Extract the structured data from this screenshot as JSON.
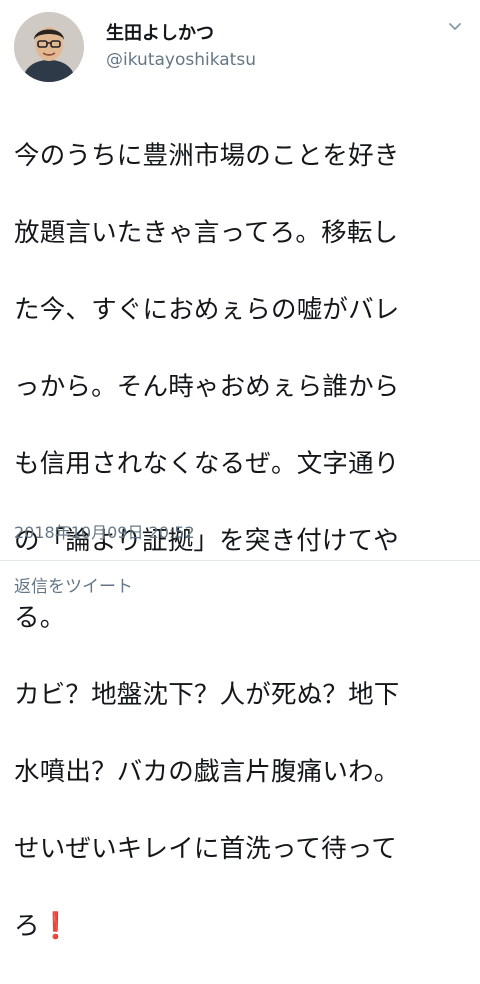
{
  "tweet": {
    "author": {
      "display_name": "生田よしかつ",
      "handle": "@ikutayoshikatsu",
      "avatar_icon": "user-avatar"
    },
    "menu_icon": "chevron-down-icon",
    "lines": [
      "今のうちに豊洲市場のことを好き",
      "放題言いたきゃ言ってろ。移転し",
      "た今、すぐにおめぇらの嘘がバレ",
      "っから。そん時ゃおめぇら誰から",
      "も信用されなくなるぜ。文字通り",
      "の「論より証拠」を突き付けてや",
      "る。",
      "カビ？地盤沈下？人が死ぬ？地下",
      "水噴出？バカの戯言片腹痛いわ。",
      "せいぜいキレイに首洗って待って",
      "ろ"
    ],
    "emoji": "❗",
    "timestamp": "2018年10月09日 20:52",
    "reply_label": "返信をツイート"
  },
  "colors": {
    "text": "#14171a",
    "secondary": "#657786",
    "divider": "#e1e8ed",
    "emoji_red": "#e0201c"
  }
}
